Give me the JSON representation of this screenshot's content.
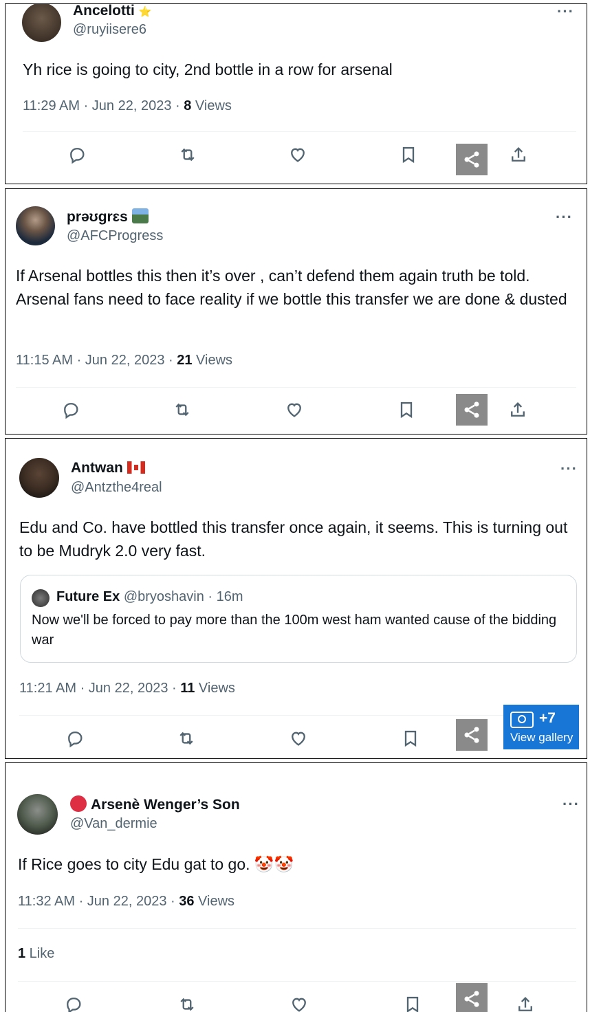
{
  "colors": {
    "share_bg": "#8a8a8a",
    "gallery_bg": "#1877d6",
    "muted": "#536471"
  },
  "tweets": [
    {
      "name": "Ancelotti",
      "name_emoji": "⭐",
      "handle": "@ruyiisere6",
      "text": "Yh rice is going to city, 2nd bottle in a row for arsenal",
      "time": "11:29 AM · Jun 22, 2023 · ",
      "views": "8",
      "views_label": " Views"
    },
    {
      "name": "prəʊgrɛs",
      "handle": "@AFCProgress",
      "text": "If Arsenal bottles this then it’s over , can’t defend them again truth be told. Arsenal fans need to face reality if we bottle this transfer we are done & dusted",
      "time": "11:15 AM · Jun 22, 2023 · ",
      "views": "21",
      "views_label": " Views"
    },
    {
      "name": "Antwan",
      "handle": "@Antzthe4real",
      "text": "Edu and Co. have bottled this transfer once again, it seems. This is turning out to be Mudryk 2.0 very fast.",
      "quote": {
        "name": "Future Ex",
        "handle": "@bryoshavin · 16m",
        "text": "Now we'll be forced to pay more than the 100m west ham wanted cause of the bidding war"
      },
      "time": "11:21 AM · Jun 22, 2023 · ",
      "views": "11",
      "views_label": " Views"
    },
    {
      "name": "Arsenè Wenger’s Son",
      "handle": "@Van_dermie",
      "text": "If Rice goes to city Edu gat to go. 🤡🤡",
      "time": "11:32 AM · Jun 22, 2023 · ",
      "views": "36",
      "views_label": " Views",
      "likes_count": "1",
      "likes_label": " Like"
    }
  ],
  "gallery": {
    "count": "+7",
    "label": "View gallery"
  },
  "more_label": "···"
}
